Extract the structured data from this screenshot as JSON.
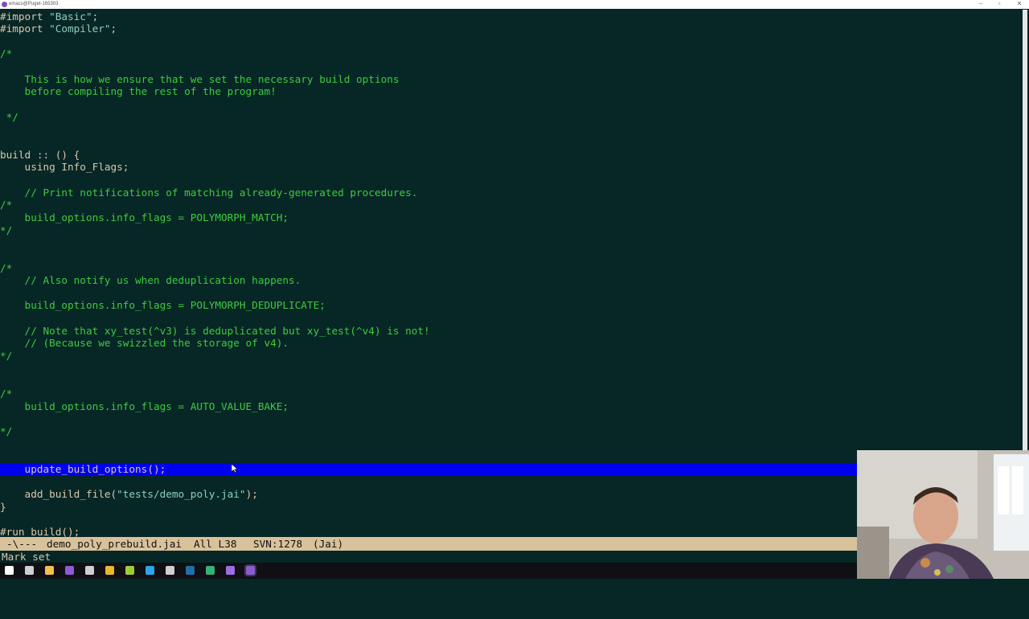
{
  "window": {
    "title": "emacs@Puget-165303"
  },
  "editor": {
    "lines": [
      {
        "row": 0,
        "spans": [
          {
            "t": "#import ",
            "c": "plain"
          },
          {
            "t": "\"Basic\"",
            "c": "str"
          },
          {
            "t": ";",
            "c": "plain"
          }
        ]
      },
      {
        "row": 1,
        "spans": [
          {
            "t": "#import ",
            "c": "plain"
          },
          {
            "t": "\"Compiler\"",
            "c": "str"
          },
          {
            "t": ";",
            "c": "plain"
          }
        ]
      },
      {
        "row": 3,
        "spans": [
          {
            "t": "/*",
            "c": "comment"
          }
        ]
      },
      {
        "row": 5,
        "spans": [
          {
            "t": "    This is how we ensure that we set the necessary build options",
            "c": "comment"
          }
        ]
      },
      {
        "row": 6,
        "spans": [
          {
            "t": "    before compiling the rest of the program!",
            "c": "comment"
          }
        ]
      },
      {
        "row": 8,
        "spans": [
          {
            "t": " */",
            "c": "comment"
          }
        ]
      },
      {
        "row": 11,
        "spans": [
          {
            "t": "build :: () {",
            "c": "plain"
          }
        ]
      },
      {
        "row": 12,
        "spans": [
          {
            "t": "    using Info_Flags;",
            "c": "plain"
          }
        ]
      },
      {
        "row": 14,
        "spans": [
          {
            "t": "    // Print notifications of matching already-generated procedures.",
            "c": "comment"
          }
        ]
      },
      {
        "row": 15,
        "spans": [
          {
            "t": "/*",
            "c": "comment"
          }
        ]
      },
      {
        "row": 16,
        "spans": [
          {
            "t": "    build_options.info_flags = POLYMORPH_MATCH;",
            "c": "comment"
          }
        ]
      },
      {
        "row": 17,
        "spans": [
          {
            "t": "*/",
            "c": "comment"
          }
        ]
      },
      {
        "row": 20,
        "spans": [
          {
            "t": "/*",
            "c": "comment"
          }
        ]
      },
      {
        "row": 21,
        "spans": [
          {
            "t": "    // Also notify us when deduplication happens.",
            "c": "comment"
          }
        ]
      },
      {
        "row": 23,
        "spans": [
          {
            "t": "    build_options.info_flags = POLYMORPH_DEDUPLICATE;",
            "c": "comment"
          }
        ]
      },
      {
        "row": 25,
        "spans": [
          {
            "t": "    // Note that xy_test(^v3) is deduplicated but xy_test(^v4) is not!",
            "c": "comment"
          }
        ]
      },
      {
        "row": 26,
        "spans": [
          {
            "t": "    // (Because we swizzled the storage of v4).",
            "c": "comment"
          }
        ]
      },
      {
        "row": 27,
        "spans": [
          {
            "t": "*/",
            "c": "comment"
          }
        ]
      },
      {
        "row": 30,
        "spans": [
          {
            "t": "/*",
            "c": "comment"
          }
        ]
      },
      {
        "row": 31,
        "spans": [
          {
            "t": "    build_options.info_flags = AUTO_VALUE_BAKE;",
            "c": "comment"
          }
        ]
      },
      {
        "row": 33,
        "spans": [
          {
            "t": "*/",
            "c": "comment"
          }
        ]
      },
      {
        "row": 36,
        "spans": [
          {
            "t": "    update_build_options();",
            "c": "plain"
          }
        ],
        "highlight": true
      },
      {
        "row": 38,
        "spans": [
          {
            "t": "    add_build_file(",
            "c": "plain"
          },
          {
            "t": "\"tests/demo_poly.jai\"",
            "c": "str"
          },
          {
            "t": ");",
            "c": "plain"
          }
        ]
      },
      {
        "row": 39,
        "spans": [
          {
            "t": "}",
            "c": "plain"
          }
        ]
      },
      {
        "row": 41,
        "spans": [
          {
            "t": "#run build();",
            "c": "plain"
          }
        ]
      }
    ]
  },
  "modeline": {
    "status": "-\\---",
    "buffer": "demo_poly_prebuild.jai",
    "position": "All L38",
    "vc": "SVN:1278",
    "mode": "(Jai)"
  },
  "minibuffer": {
    "message": "Mark set"
  },
  "taskbar": {
    "icons": [
      {
        "name": "windows-start-icon",
        "color": "#ffffff"
      },
      {
        "name": "task-view-icon",
        "color": "#cfcfcf"
      },
      {
        "name": "file-explorer-icon",
        "color": "#f2c14e"
      },
      {
        "name": "emacs-icon",
        "color": "#8a5cd1"
      },
      {
        "name": "settings-icon",
        "color": "#cfcfcf"
      },
      {
        "name": "chrome-icon",
        "color": "#e9b72b"
      },
      {
        "name": "app-green-icon",
        "color": "#9ccc35"
      },
      {
        "name": "app-blue-icon",
        "color": "#2aa6e8"
      },
      {
        "name": "tools-icon",
        "color": "#cfcfcf"
      },
      {
        "name": "photoshop-icon",
        "color": "#1f6fa8"
      },
      {
        "name": "app-teal-icon",
        "color": "#33b27a"
      },
      {
        "name": "visual-studio-icon",
        "color": "#9b6ee0"
      },
      {
        "name": "emacs-active-icon",
        "color": "#8a5cd1"
      }
    ]
  },
  "colors": {
    "background": "#072626",
    "plain_text": "#d9c9a8",
    "comment": "#3ccd3c",
    "string": "#8ecfc2",
    "highlight": "#0000f0",
    "modeline": "#d9c29b"
  }
}
